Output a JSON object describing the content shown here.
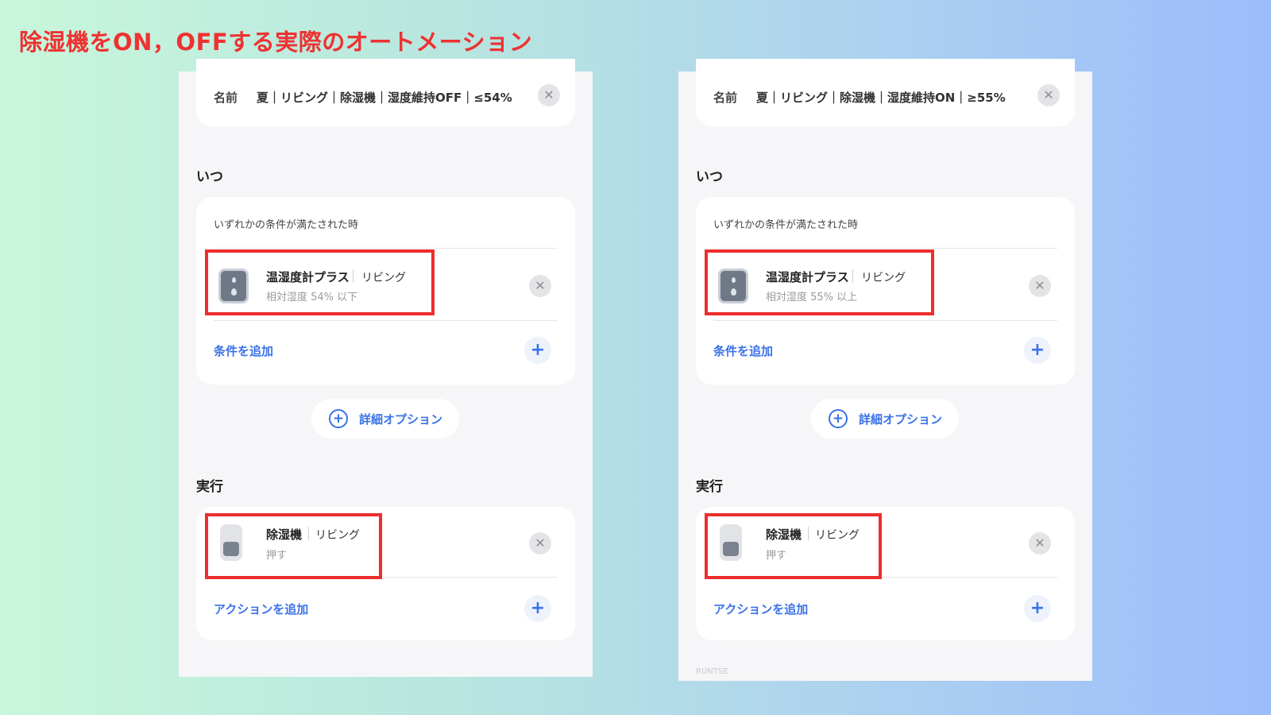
{
  "headline": "除湿機をON，OFFする実際のオートメーション",
  "common": {
    "name_label": "名前",
    "when_title": "いつ",
    "cond_hint": "いずれかの条件が満たされた時",
    "add_condition": "条件を追加",
    "advanced_options": "詳細オプション",
    "exec_title": "実行",
    "add_action": "アクションを追加",
    "close_glyph": "✕",
    "plus_glyph": "+"
  },
  "panels": [
    {
      "name_value": "夏｜リビング｜除湿機｜湿度維持OFF｜≤54%",
      "condition": {
        "device": "温湿度計プラス",
        "room": "リビング",
        "detail": "相対湿度 54% 以下",
        "icon": "thermo-hygrometer-icon"
      },
      "action": {
        "device": "除湿機",
        "room": "リビング",
        "detail": "押す",
        "icon": "dehumidifier-icon"
      }
    },
    {
      "name_value": "夏｜リビング｜除湿機｜湿度維持ON｜≥55%",
      "condition": {
        "device": "温湿度計プラス",
        "room": "リビング",
        "detail": "相対湿度 55% 以上",
        "icon": "thermo-hygrometer-icon"
      },
      "action": {
        "device": "除湿機",
        "room": "リビング",
        "detail": "押す",
        "icon": "dehumidifier-icon"
      },
      "footer_faint": "RUNTSE"
    }
  ],
  "colors": {
    "headline": "#ef3131",
    "accent": "#3a72e8",
    "highlight": "#ee2d2d"
  }
}
